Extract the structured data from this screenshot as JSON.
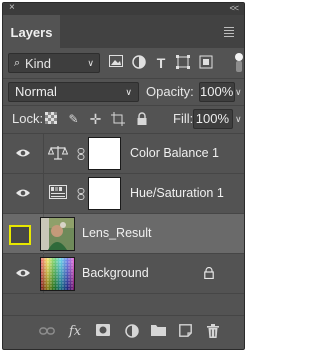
{
  "panel": {
    "close_glyph": "×",
    "collapse_glyph": "<<",
    "tab_title": "Layers"
  },
  "filter": {
    "kind_label": "Kind",
    "icons": [
      "image-filter-icon",
      "adjustment-filter-icon",
      "type-filter-icon",
      "shape-filter-icon",
      "smart-object-filter-icon",
      "filter-toggle-icon"
    ]
  },
  "blending": {
    "mode": "Normal",
    "opacity_label": "Opacity:",
    "opacity_value": "100%",
    "lock_label": "Lock:",
    "fill_label": "Fill:",
    "fill_value": "100%"
  },
  "layers": [
    {
      "name": "Color Balance 1",
      "type": "adjustment",
      "icon": "color-balance-icon",
      "visible": true
    },
    {
      "name": "Hue/Saturation 1",
      "type": "adjustment",
      "icon": "hue-saturation-icon",
      "visible": true
    },
    {
      "name": "Lens_Result",
      "type": "pixel",
      "visible": false,
      "selected": true
    },
    {
      "name": "Background",
      "type": "pixel",
      "visible": true,
      "locked": true
    }
  ],
  "bottom_icons": [
    "link-icon",
    "fx-icon",
    "add-mask-icon",
    "new-adjustment-icon",
    "new-group-icon",
    "new-layer-icon",
    "delete-icon"
  ],
  "colors": {
    "panel_bg": "#535353",
    "selected_row": "#6a6a6a",
    "highlight_box": "#e8e800"
  }
}
